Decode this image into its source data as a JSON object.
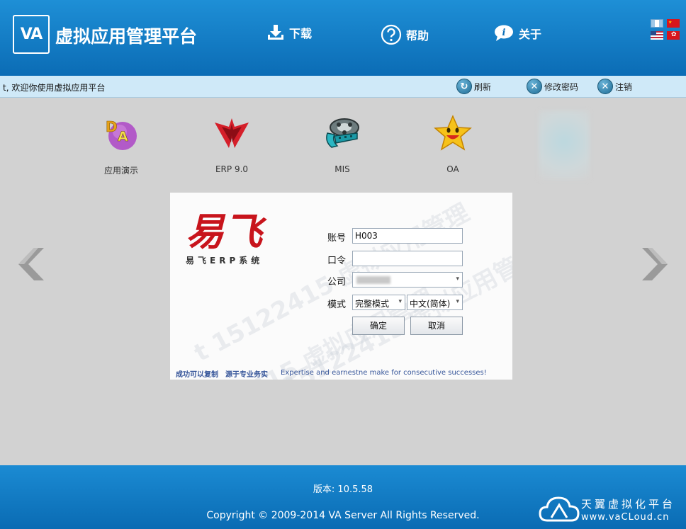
{
  "header": {
    "logo": "VA",
    "title": "虚拟应用管理平台",
    "nav": [
      {
        "label": "下载",
        "icon": "download-icon"
      },
      {
        "label": "帮助",
        "icon": "help-icon"
      },
      {
        "label": "关于",
        "icon": "info-icon"
      }
    ]
  },
  "toolbar": {
    "welcome": "t, 欢迎你使用虚拟应用平台",
    "refresh_label": "刷新",
    "change_password_label": "修改密码",
    "logout_label": "注销"
  },
  "apps": [
    {
      "label": "应用演示",
      "icon": "da-demo-icon"
    },
    {
      "label": "ERP 9.0",
      "icon": "erp-icon"
    },
    {
      "label": "MIS",
      "icon": "film-reel-icon"
    },
    {
      "label": "OA",
      "icon": "star-face-icon"
    }
  ],
  "login": {
    "brand_logo_text": "易飞",
    "brand_sub": "易飞ERP系统",
    "watermark": "t 15122415 虚拟应用管理",
    "account_label": "账号",
    "account_value": "H003",
    "password_label": "口令",
    "password_value": "",
    "company_label": "公司",
    "mode_label": "模式",
    "mode_value": "完整模式",
    "language_value": "中文(简体)",
    "confirm_label": "确定",
    "cancel_label": "取消",
    "slogan_cn": "成功可以复制　源于专业务实",
    "slogan_en": "Expertise and earnestne make for consecutive successes!"
  },
  "footer": {
    "version": "版本: 10.5.58",
    "copyright": "Copyright © 2009-2014 VA Server All Rights Reserved.",
    "watermark_name": "天翼虚拟化平台",
    "watermark_url": "www.vaCLoud.cn"
  },
  "colors": {
    "header_blue": "#0b6cb5",
    "toolbar_bg": "#cfe9f8",
    "page_bg": "#d2d2d2",
    "slogan": "#37569a"
  }
}
